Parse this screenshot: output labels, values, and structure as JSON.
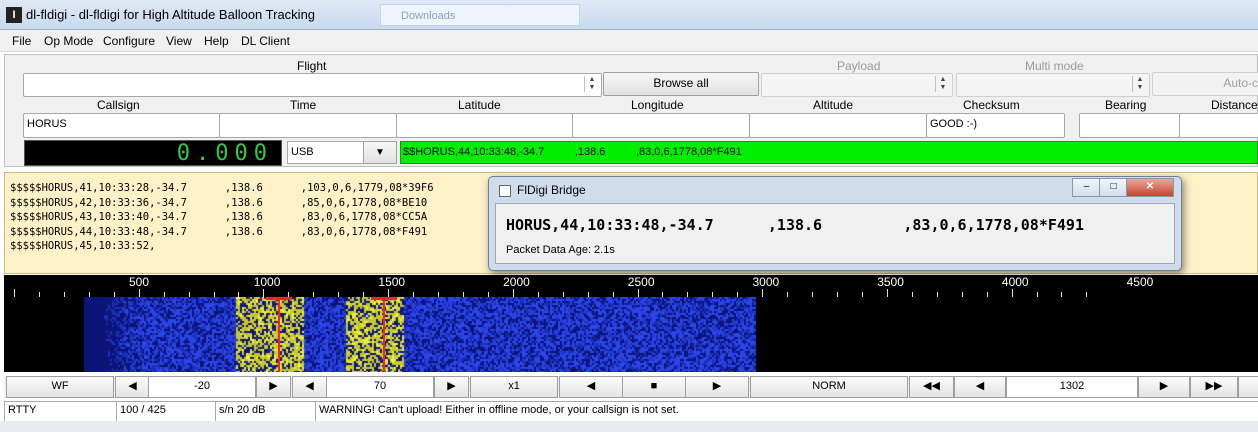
{
  "window": {
    "title": "dl-fldigi - dl-fldigi for High Altitude Balloon Tracking",
    "bg_tab": "Downloads"
  },
  "menu": [
    "File",
    "Op Mode",
    "Configure",
    "View",
    "Help",
    "DL Client"
  ],
  "flight": {
    "flight_label": "Flight",
    "payload_label": "Payload",
    "multimode_label": "Multi mode",
    "browse_label": "Browse all",
    "auto_label": "Auto-c",
    "columns": {
      "callsign": "Callsign",
      "time": "Time",
      "latitude": "Latitude",
      "longitude": "Longitude",
      "altitude": "Altitude",
      "checksum": "Checksum",
      "bearing": "Bearing",
      "distance": "Distance"
    },
    "values": {
      "callsign": "HORUS",
      "time": "",
      "latitude": "",
      "longitude": "",
      "altitude": "",
      "checksum": "GOOD :-)",
      "bearing": "",
      "distance": ""
    }
  },
  "rig": {
    "frequency": "0.000",
    "mode": "USB",
    "rx_line": "$$HORUS,44,10:33:48,-34.7          ,138.6          ,83,0,6,1778,08*F491"
  },
  "rx_lines": [
    "$$$$$HORUS,41,10:33:28,-34.7      ,138.6      ,103,0,6,1779,08*39F6",
    "$$$$$HORUS,42,10:33:36,-34.7      ,138.6      ,85,0,6,1778,08*BE10",
    "$$$$$HORUS,43,10:33:40,-34.7      ,138.6      ,83,0,6,1778,08*CC5A",
    "$$$$$HORUS,44,10:33:48,-34.7      ,138.6      ,83,0,6,1778,08*F491",
    "$$$$$HORUS,45,10:33:52,"
  ],
  "bridge": {
    "title": "FlDigi Bridge",
    "sentence": "HORUS,44,10:33:48,-34.7      ,138.6         ,83,0,6,1778,08*F491",
    "age": "Packet Data Age: 2.1s"
  },
  "waterfall": {
    "scale_labels": [
      "500",
      "1000",
      "1500",
      "2000",
      "2500",
      "3000",
      "3500",
      "4000",
      "4500"
    ],
    "marker_color": "#ff2020",
    "signal_color": "#e0e020",
    "noise_color": "#1a2fd0"
  },
  "controls": {
    "wf": "WF",
    "offset": "-20",
    "range": "70",
    "zoom": "x1",
    "speed": "NORM",
    "carrier": "1302"
  },
  "status": {
    "mode": "RTTY",
    "rate": "100 / 425",
    "sn": "s/n  20 dB",
    "message": "WARNING! Can't upload! Either in offline mode, or your callsign is not set."
  }
}
